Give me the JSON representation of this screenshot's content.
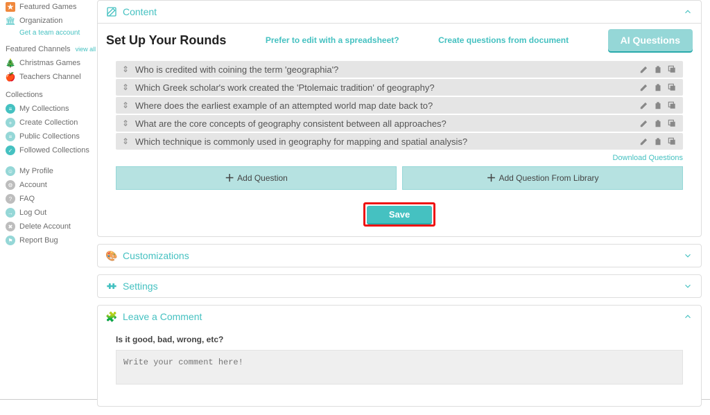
{
  "sidebar": {
    "topItems": [
      {
        "label": "Featured Games",
        "icon": "star-icon",
        "iconBg": "#f0883d",
        "glyph": "★"
      },
      {
        "label": "Organization",
        "icon": "org-icon",
        "iconBg": "#95d7d7",
        "glyph": "🏢"
      }
    ],
    "teamLink": "Get a team account",
    "featuredTitle": "Featured Channels",
    "viewAll": "view all",
    "featured": [
      {
        "label": "Christmas Games",
        "icon": "tree-icon",
        "glyph": "🎄"
      },
      {
        "label": "Teachers Channel",
        "icon": "apple-icon",
        "glyph": "🍎"
      }
    ],
    "collectionsTitle": "Collections",
    "collections": [
      {
        "label": "My Collections",
        "class": "sb-teal",
        "glyph": "≡"
      },
      {
        "label": "Create Collection",
        "class": "sb-teal-light",
        "glyph": "+"
      },
      {
        "label": "Public Collections",
        "class": "sb-teal-light",
        "glyph": "≡"
      },
      {
        "label": "Followed Collections",
        "class": "sb-teal",
        "glyph": "✓"
      }
    ],
    "account": [
      {
        "label": "My Profile",
        "glyph": "👤"
      },
      {
        "label": "Account",
        "glyph": "⚙"
      },
      {
        "label": "FAQ",
        "glyph": "?"
      },
      {
        "label": "Log Out",
        "glyph": "→"
      },
      {
        "label": "Delete Account",
        "glyph": "✖"
      },
      {
        "label": "Report Bug",
        "glyph": "⚑"
      }
    ]
  },
  "content": {
    "panelTitle": "Content",
    "heading": "Set Up Your Rounds",
    "spreadsheetLink": "Prefer to edit with a spreadsheet?",
    "docLink": "Create questions from document",
    "aiButton": "AI Questions",
    "questions": [
      "Who is credited with coining the term 'geographia'?",
      "Which Greek scholar's work created the 'Ptolemaic tradition' of geography?",
      "Where does the earliest example of an attempted world map date back to?",
      "What are the core concepts of geography consistent between all approaches?",
      "Which technique is commonly used in geography for mapping and spatial analysis?"
    ],
    "downloadLink": "Download Questions",
    "addQuestion": "Add Question",
    "addFromLibrary": "Add Question From Library",
    "saveLabel": "Save"
  },
  "customizations": {
    "title": "Customizations"
  },
  "settings": {
    "title": "Settings"
  },
  "comment": {
    "title": "Leave a Comment",
    "prompt": "Is it good, bad, wrong, etc?",
    "placeholder": "Write your comment here!"
  }
}
